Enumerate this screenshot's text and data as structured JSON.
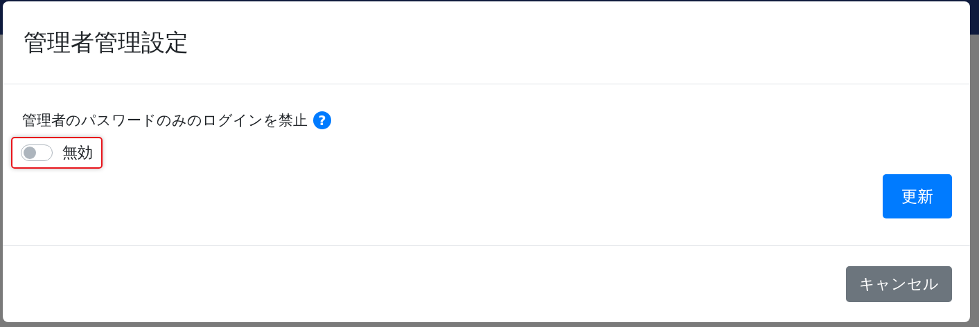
{
  "dialog": {
    "title": "管理者管理設定",
    "setting": {
      "label": "管理者のパスワードのみのログインを禁止",
      "help_icon": "?"
    },
    "toggle": {
      "label": "無効",
      "on": false,
      "highlighted": true
    },
    "update_button": "更新",
    "cancel_button": "キャンセル"
  }
}
